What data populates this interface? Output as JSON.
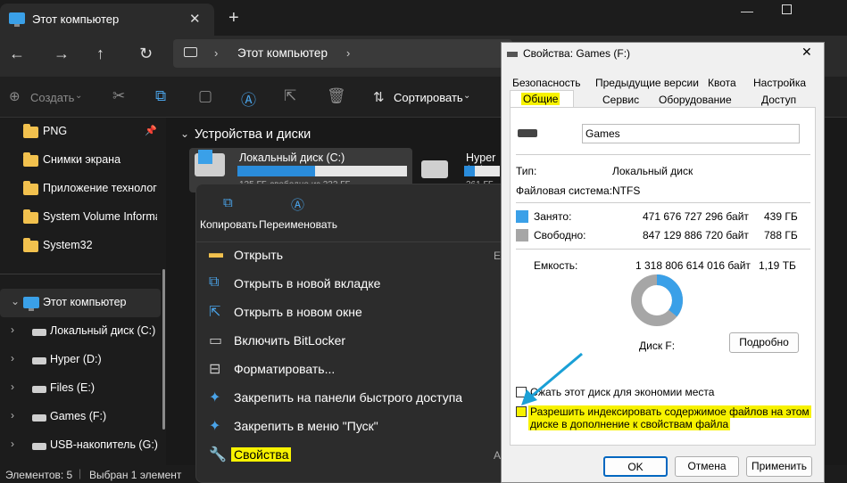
{
  "window": {
    "tab_title": "Этот компьютер",
    "address": "Этот компьютер"
  },
  "toolbar": {
    "create_label": "Создать",
    "sort_label": "Сортировать"
  },
  "sidebar": {
    "quick": [
      "PNG",
      "Снимки экрана",
      "Приложение технолог",
      "System Volume Informat",
      "System32"
    ],
    "this_pc": "Этот компьютер",
    "drives": [
      "Локальный диск (C:)",
      "Hyper (D:)",
      "Files (E:)",
      "Games (F:)",
      "USB-накопитель (G:)"
    ]
  },
  "main": {
    "section_title": "Устройства и диски",
    "drive1": {
      "name": "Локальный диск (C:)",
      "sub": "125 ГБ свободно из 232 ГБ",
      "fill": 0.46
    },
    "drive2": {
      "name": "Hyper (D:)",
      "sub": "261 ГБ",
      "fill": 0.3
    }
  },
  "menu": {
    "copy": "Копировать",
    "rename": "Переименовать",
    "items": [
      "Открыть",
      "Открыть в новой вкладке",
      "Открыть в новом окне",
      "Включить BitLocker",
      "Форматировать...",
      "Закрепить на панели быстрого доступа",
      "Закрепить в меню \"Пуск\"",
      "Свойства"
    ],
    "shortcut_open": "Er",
    "shortcut_props": "Al"
  },
  "status": {
    "count": "Элементов: 5",
    "selected": "Выбран 1 элемент"
  },
  "dialog": {
    "title": "Свойства: Games (F:)",
    "tabs_row1": [
      "Безопасность",
      "Предыдущие версии",
      "Квота",
      "Настройка"
    ],
    "tabs_row2": [
      "Общие",
      "Сервис",
      "Оборудование",
      "Доступ"
    ],
    "name_value": "Games",
    "type_label": "Тип:",
    "type_value": "Локальный диск",
    "fs_label": "Файловая система:",
    "fs_value": "NTFS",
    "used_label": "Занято:",
    "used_bytes": "471 676 727 296 байт",
    "used_gb": "439 ГБ",
    "free_label": "Свободно:",
    "free_bytes": "847 129 886 720 байт",
    "free_gb": "788 ГБ",
    "cap_label": "Емкость:",
    "cap_bytes": "1 318 806 614 016 байт",
    "cap_gb": "1,19 ТБ",
    "used_fraction": 0.358,
    "disk_label": "Диск F:",
    "details_button": "Подробно",
    "compress_label": "Сжать этот диск для экономии места",
    "index_label_1": "Разрешить индексировать содержимое файлов на этом",
    "index_label_2": "диске в дополнение к свойствам файла",
    "ok": "OK",
    "cancel": "Отмена",
    "apply": "Применить",
    "colors": {
      "used": "#3aa0e8",
      "free": "#a6a6a6",
      "highlight": "#f7f200",
      "arrow": "#1aa0d6"
    }
  }
}
